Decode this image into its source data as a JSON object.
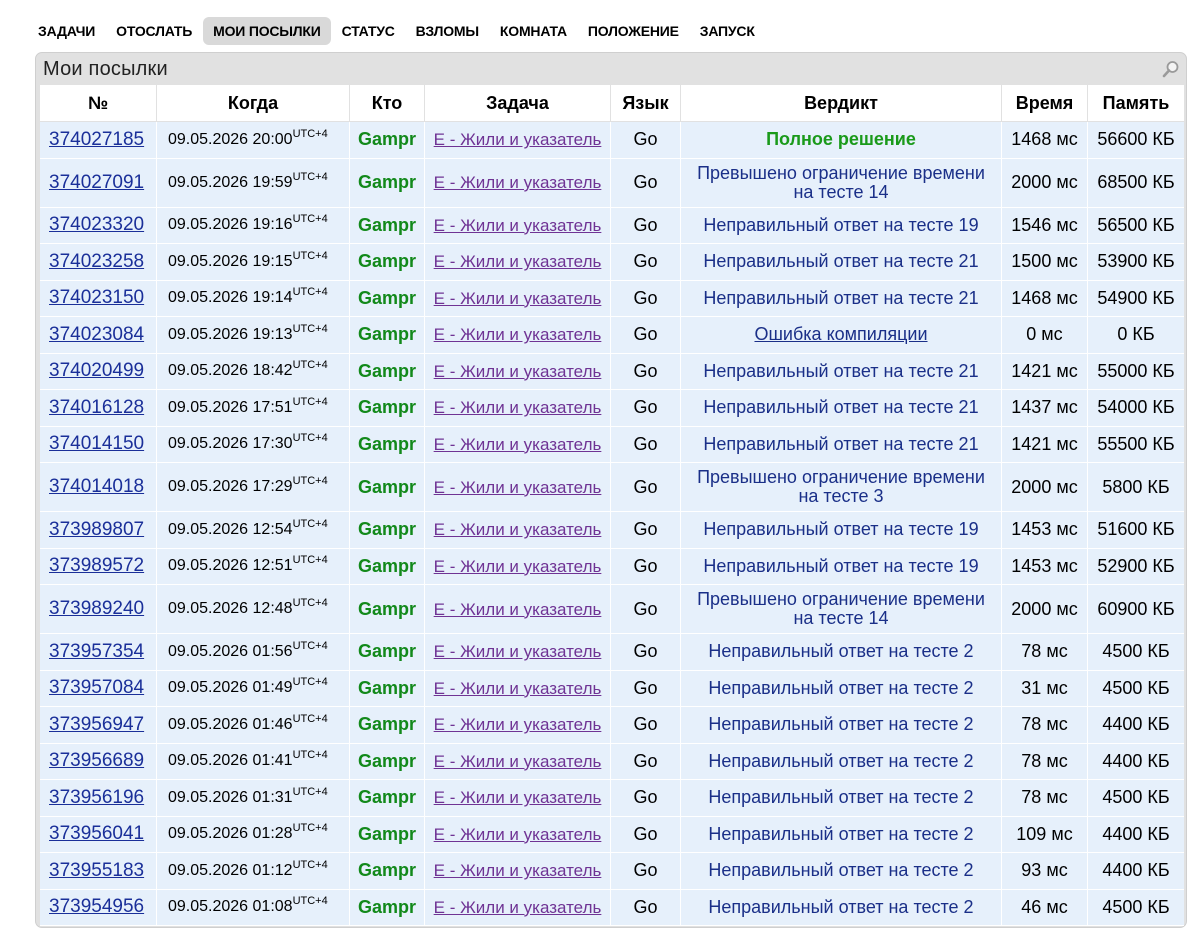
{
  "nav": {
    "items": [
      "ЗАДАЧИ",
      "ОТОСЛАТЬ",
      "МОИ ПОСЫЛКИ",
      "СТАТУС",
      "ВЗЛОМЫ",
      "КОМНАТА",
      "ПОЛОЖЕНИЕ",
      "ЗАПУСК"
    ],
    "selected_index": 2
  },
  "panel": {
    "title": "Мои посылки",
    "search_icon": "magnifier-icon"
  },
  "table": {
    "headers": [
      "№",
      "Когда",
      "Кто",
      "Задача",
      "Язык",
      "Вердикт",
      "Время",
      "Память"
    ],
    "tz": "UTC+4",
    "rows": [
      {
        "id": "374027185",
        "when": "09.05.2026 20:00",
        "who": "Gampr",
        "problem": "E - Жили и указатель",
        "lang": "Go",
        "verdict": "Полное решение",
        "vtype": "ok",
        "time": "1468 мс",
        "mem": "56600 КБ"
      },
      {
        "id": "374027091",
        "when": "09.05.2026 19:59",
        "who": "Gampr",
        "problem": "E - Жили и указатель",
        "lang": "Go",
        "verdict": "Превышено ограничение времени на тесте 14",
        "vtype": "tl",
        "time": "2000 мс",
        "mem": "68500 КБ"
      },
      {
        "id": "374023320",
        "when": "09.05.2026 19:16",
        "who": "Gampr",
        "problem": "E - Жили и указатель",
        "lang": "Go",
        "verdict": "Неправильный ответ на тесте 19",
        "vtype": "wa",
        "time": "1546 мс",
        "mem": "56500 КБ"
      },
      {
        "id": "374023258",
        "when": "09.05.2026 19:15",
        "who": "Gampr",
        "problem": "E - Жили и указатель",
        "lang": "Go",
        "verdict": "Неправильный ответ на тесте 21",
        "vtype": "wa",
        "time": "1500 мс",
        "mem": "53900 КБ"
      },
      {
        "id": "374023150",
        "when": "09.05.2026 19:14",
        "who": "Gampr",
        "problem": "E - Жили и указатель",
        "lang": "Go",
        "verdict": "Неправильный ответ на тесте 21",
        "vtype": "wa",
        "time": "1468 мс",
        "mem": "54900 КБ"
      },
      {
        "id": "374023084",
        "when": "09.05.2026 19:13",
        "who": "Gampr",
        "problem": "E - Жили и указатель",
        "lang": "Go",
        "verdict": "Ошибка компиляции",
        "vtype": "ce",
        "time": "0 мс",
        "mem": "0 КБ"
      },
      {
        "id": "374020499",
        "when": "09.05.2026 18:42",
        "who": "Gampr",
        "problem": "E - Жили и указатель",
        "lang": "Go",
        "verdict": "Неправильный ответ на тесте 21",
        "vtype": "wa",
        "time": "1421 мс",
        "mem": "55000 КБ"
      },
      {
        "id": "374016128",
        "when": "09.05.2026 17:51",
        "who": "Gampr",
        "problem": "E - Жили и указатель",
        "lang": "Go",
        "verdict": "Неправильный ответ на тесте 21",
        "vtype": "wa",
        "time": "1437 мс",
        "mem": "54000 КБ"
      },
      {
        "id": "374014150",
        "when": "09.05.2026 17:30",
        "who": "Gampr",
        "problem": "E - Жили и указатель",
        "lang": "Go",
        "verdict": "Неправильный ответ на тесте 21",
        "vtype": "wa",
        "time": "1421 мс",
        "mem": "55500 КБ"
      },
      {
        "id": "374014018",
        "when": "09.05.2026 17:29",
        "who": "Gampr",
        "problem": "E - Жили и указатель",
        "lang": "Go",
        "verdict": "Превышено ограничение времени на тесте 3",
        "vtype": "tl",
        "time": "2000 мс",
        "mem": "5800 КБ"
      },
      {
        "id": "373989807",
        "when": "09.05.2026 12:54",
        "who": "Gampr",
        "problem": "E - Жили и указатель",
        "lang": "Go",
        "verdict": "Неправильный ответ на тесте 19",
        "vtype": "wa",
        "time": "1453 мс",
        "mem": "51600 КБ"
      },
      {
        "id": "373989572",
        "when": "09.05.2026 12:51",
        "who": "Gampr",
        "problem": "E - Жили и указатель",
        "lang": "Go",
        "verdict": "Неправильный ответ на тесте 19",
        "vtype": "wa",
        "time": "1453 мс",
        "mem": "52900 КБ"
      },
      {
        "id": "373989240",
        "when": "09.05.2026 12:48",
        "who": "Gampr",
        "problem": "E - Жили и указатель",
        "lang": "Go",
        "verdict": "Превышено ограничение времени на тесте 14",
        "vtype": "tl",
        "time": "2000 мс",
        "mem": "60900 КБ"
      },
      {
        "id": "373957354",
        "when": "09.05.2026 01:56",
        "who": "Gampr",
        "problem": "E - Жили и указатель",
        "lang": "Go",
        "verdict": "Неправильный ответ на тесте 2",
        "vtype": "wa",
        "time": "78 мс",
        "mem": "4500 КБ"
      },
      {
        "id": "373957084",
        "when": "09.05.2026 01:49",
        "who": "Gampr",
        "problem": "E - Жили и указатель",
        "lang": "Go",
        "verdict": "Неправильный ответ на тесте 2",
        "vtype": "wa",
        "time": "31 мс",
        "mem": "4500 КБ"
      },
      {
        "id": "373956947",
        "when": "09.05.2026 01:46",
        "who": "Gampr",
        "problem": "E - Жили и указатель",
        "lang": "Go",
        "verdict": "Неправильный ответ на тесте 2",
        "vtype": "wa",
        "time": "78 мс",
        "mem": "4400 КБ"
      },
      {
        "id": "373956689",
        "when": "09.05.2026 01:41",
        "who": "Gampr",
        "problem": "E - Жили и указатель",
        "lang": "Go",
        "verdict": "Неправильный ответ на тесте 2",
        "vtype": "wa",
        "time": "78 мс",
        "mem": "4400 КБ"
      },
      {
        "id": "373956196",
        "when": "09.05.2026 01:31",
        "who": "Gampr",
        "problem": "E - Жили и указатель",
        "lang": "Go",
        "verdict": "Неправильный ответ на тесте 2",
        "vtype": "wa",
        "time": "78 мс",
        "mem": "4500 КБ"
      },
      {
        "id": "373956041",
        "when": "09.05.2026 01:28",
        "who": "Gampr",
        "problem": "E - Жили и указатель",
        "lang": "Go",
        "verdict": "Неправильный ответ на тесте 2",
        "vtype": "wa",
        "time": "109 мс",
        "mem": "4400 КБ"
      },
      {
        "id": "373955183",
        "when": "09.05.2026 01:12",
        "who": "Gampr",
        "problem": "E - Жили и указатель",
        "lang": "Go",
        "verdict": "Неправильный ответ на тесте 2",
        "vtype": "wa",
        "time": "93 мс",
        "mem": "4400 КБ"
      },
      {
        "id": "373954956",
        "when": "09.05.2026 01:08",
        "who": "Gampr",
        "problem": "E - Жили и указатель",
        "lang": "Go",
        "verdict": "Неправильный ответ на тесте 2",
        "vtype": "wa",
        "time": "46 мс",
        "mem": "4500 КБ"
      }
    ]
  },
  "colors": {
    "row_bg": "#e6f0fb",
    "link_id": "#1a2f99",
    "link_problem": "#6f3394",
    "handle": "#12891a",
    "verdict_ok": "#1a9a1a",
    "verdict_fail": "#1a2f88",
    "frame": "#e1e1e1",
    "nav_selected": "#d9d9d9"
  }
}
